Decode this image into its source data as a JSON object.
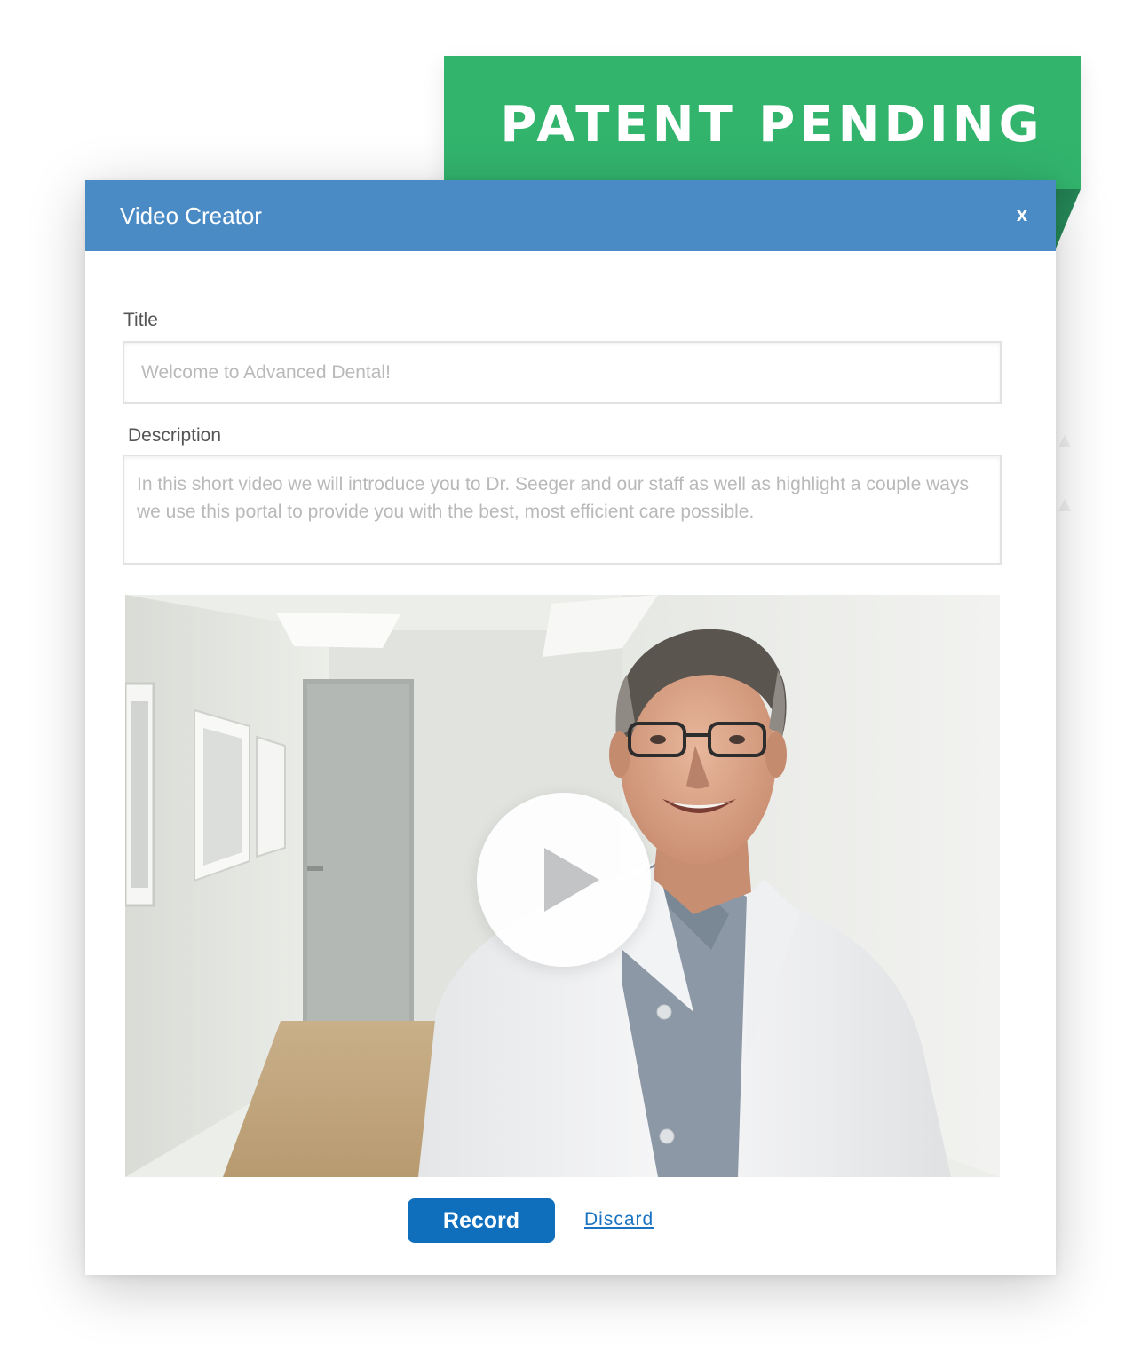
{
  "badge": {
    "text": "PATENT PENDING",
    "color": "#32b46d"
  },
  "dialog": {
    "title": "Video Creator",
    "close_label": "x",
    "header_color": "#4b8bc5"
  },
  "form": {
    "title_label": "Title",
    "title_placeholder": "Welcome to Advanced Dental!",
    "description_label": "Description",
    "description_placeholder": "In this short video we will introduce you to Dr. Seeger and our staff as well as highlight a couple ways we use this portal to provide you with the best, most efficient care possible."
  },
  "video": {
    "scene": "smiling doctor in white lab coat standing in a clinic hallway",
    "play_icon": "play-icon"
  },
  "actions": {
    "record_label": "Record",
    "discard_label": "Discard",
    "record_color": "#0f6fbd"
  }
}
